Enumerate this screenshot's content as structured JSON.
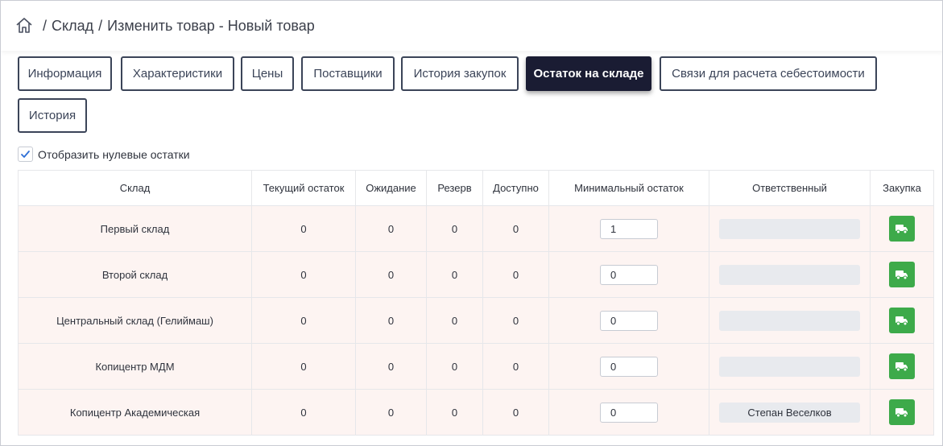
{
  "breadcrumb": {
    "items": [
      "Склад",
      "Изменить товар - Новый товар"
    ],
    "separator": "/"
  },
  "tabs": [
    {
      "label": "Информация",
      "active": false
    },
    {
      "label": "Характеристики",
      "active": false
    },
    {
      "label": "Цены",
      "active": false
    },
    {
      "label": "Поставщики",
      "active": false
    },
    {
      "label": "История закупок",
      "active": false
    },
    {
      "label": "Остаток на складе",
      "active": true
    },
    {
      "label": "Связи для расчета себестоимости",
      "active": false
    },
    {
      "label": "История",
      "active": false
    }
  ],
  "show_zero": {
    "label": "Отобразить нулевые остатки",
    "checked": true
  },
  "table": {
    "headers": [
      "Склад",
      "Текущий остаток",
      "Ожидание",
      "Резерв",
      "Доступно",
      "Минимальный остаток",
      "Ответственный",
      "Закупка"
    ],
    "rows": [
      {
        "warehouse": "Первый склад",
        "current": "0",
        "waiting": "0",
        "reserve": "0",
        "available": "0",
        "min": "1",
        "responsible": ""
      },
      {
        "warehouse": "Второй склад",
        "current": "0",
        "waiting": "0",
        "reserve": "0",
        "available": "0",
        "min": "0",
        "responsible": ""
      },
      {
        "warehouse": "Центральный склад (Гелиймаш)",
        "current": "0",
        "waiting": "0",
        "reserve": "0",
        "available": "0",
        "min": "0",
        "responsible": ""
      },
      {
        "warehouse": "Копицентр МДМ",
        "current": "0",
        "waiting": "0",
        "reserve": "0",
        "available": "0",
        "min": "0",
        "responsible": ""
      },
      {
        "warehouse": "Копицентр Академическая",
        "current": "0",
        "waiting": "0",
        "reserve": "0",
        "available": "0",
        "min": "0",
        "responsible": "Степан Веселков"
      }
    ]
  },
  "icons": {
    "home": "home-icon",
    "check": "check-icon",
    "truck": "truck-icon"
  },
  "colors": {
    "active_tab": "#1a1c33",
    "buy_button": "#3daa4a",
    "row_bg": "#fdf4f2",
    "accent": "#2f6fd6"
  }
}
